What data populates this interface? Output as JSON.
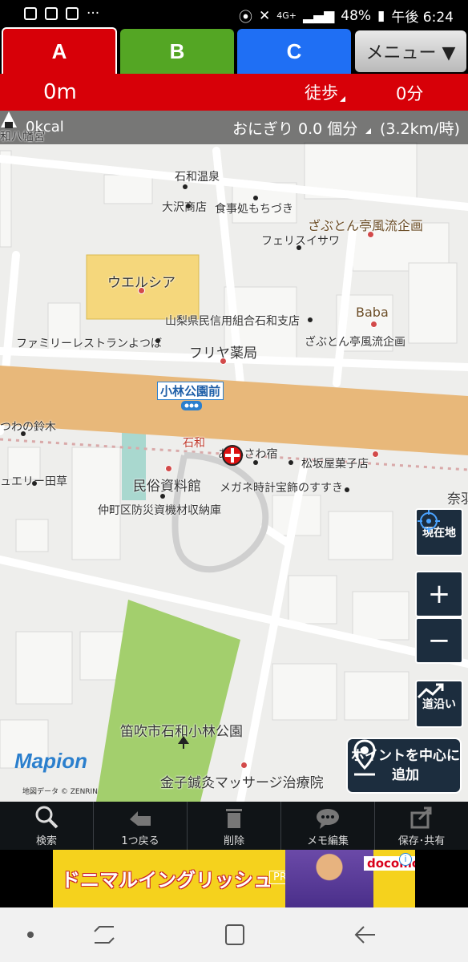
{
  "status_bar": {
    "battery": "48%",
    "time": "午後 6:24",
    "network": "4G+"
  },
  "tabs": [
    {
      "label": "A"
    },
    {
      "label": "B"
    },
    {
      "label": "C"
    }
  ],
  "menu_label": "メニュー ▼",
  "info": {
    "distance": "0m",
    "mode": "徒歩",
    "time": "0分"
  },
  "calorie": {
    "kcal": "0kcal",
    "onigiri": "おにぎり 0.0 個分",
    "speed": "(3.2km/時)"
  },
  "map_labels": {
    "ishiwa_onsen": "石和温泉",
    "osawa": "大沢商店",
    "mochizuki": "食事処もちづき",
    "zabuton1": "ざぶとん亭風流企画",
    "felice": "フェリスイサワ",
    "welcia": "ウエルシア",
    "yamanashi_bank": "山梨県民信用組合石和支店",
    "baba": "Baba",
    "zabuton2": "ざぶとん亭風流企画",
    "family_rest": "ファミリーレストランよつば",
    "furiya": "フリヤ薬局",
    "bus_stop": "小林公園前",
    "tsuwa": "つわの鈴木",
    "ishiwa": "石和",
    "isawa_inn": "あ  いさわ宿",
    "matsuzakaya": "松坂屋菓子店",
    "jewelry": "ュエリー田草",
    "minzoku": "民俗資料館",
    "megane": "メガネ時計宝飾のすすき",
    "nakamachi": "仲町区防災資機材収納庫",
    "nara": "奈羽",
    "park": "笛吹市石和小林公園",
    "kaneko": "金子鍼灸マッサージ治療院",
    "corner_top": "和八幡宮"
  },
  "buttons": {
    "location": "現在地",
    "zoom_in": "+",
    "zoom_out": "−",
    "along_road": "道沿い",
    "add_point": "ポイントを中心に追加"
  },
  "branding": {
    "logo": "Mapion",
    "copyright": "地図データ © ZENRIN"
  },
  "toolbar": [
    {
      "label": "検索",
      "icon": "search-icon"
    },
    {
      "label": "1つ戻る",
      "icon": "undo-icon"
    },
    {
      "label": "削除",
      "icon": "trash-icon"
    },
    {
      "label": "メモ編集",
      "icon": "memo-icon"
    },
    {
      "label": "保存･共有",
      "icon": "share-icon"
    }
  ],
  "ad": {
    "title": "ドニマルイングリッシュ",
    "premium": "PREMIUM",
    "brand": "docomo"
  },
  "colors": {
    "tab_a": "#d70008",
    "tab_b": "#54a624",
    "tab_c": "#1f6ff4",
    "main_road": "#e8b87a"
  }
}
